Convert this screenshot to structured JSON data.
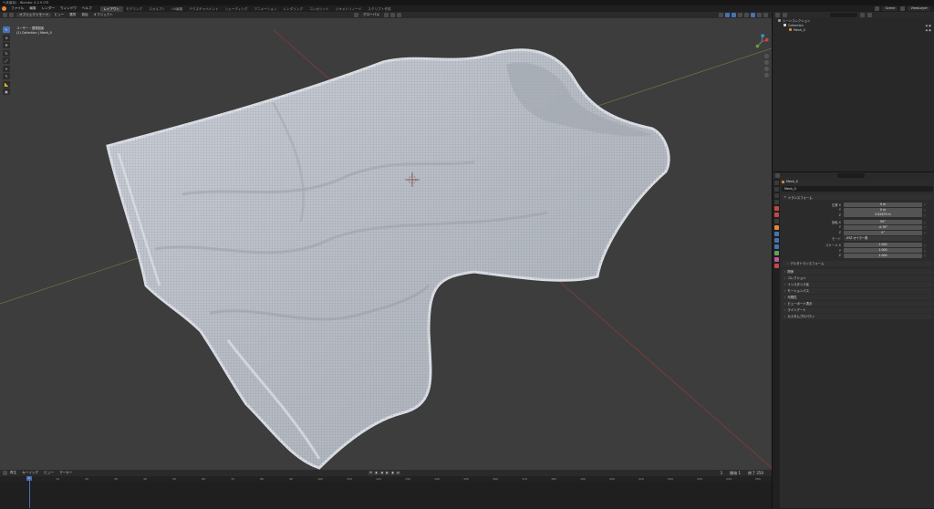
{
  "title_bar": {
    "text": "*(未保存) - Blender 4.2.9 LTS"
  },
  "menu_bar": {
    "items": [
      "ファイル",
      "編集",
      "レンダー",
      "ウィンドウ",
      "ヘルプ"
    ],
    "workspace_tabs": [
      "レイアウト",
      "モデリング",
      "スカルプト",
      "UV編集",
      "テクスチャペイント",
      "シェーディング",
      "アニメーション",
      "レンダリング",
      "コンポジット",
      "ジオメトリノード",
      "スクリプト作成"
    ],
    "active_tab_index": 0,
    "scene_label": "Scene",
    "view_layer_label": "ViewLayer"
  },
  "viewport": {
    "mode": "オブジェクトモード",
    "menus": [
      "ビュー",
      "選択",
      "追加",
      "オブジェクト"
    ],
    "transform_orientation": "グローバル",
    "info_line1": "ユーザー・透視投影",
    "info_line2": "(1) Collection | Mesh_0"
  },
  "timeline": {
    "menus": [
      "再生",
      "キーイング",
      "ビュー",
      "マーカー"
    ],
    "current_frame": "1",
    "start_label": "開始",
    "start_value": "1",
    "end_label": "終了",
    "end_value": "250",
    "ruler_marks": [
      "0",
      "10",
      "20",
      "30",
      "40",
      "50",
      "60",
      "70",
      "80",
      "90",
      "100",
      "110",
      "120",
      "130",
      "140",
      "150",
      "160",
      "170",
      "180",
      "190",
      "200",
      "210",
      "220",
      "230",
      "240",
      "250"
    ]
  },
  "outliner": {
    "rows": [
      {
        "label": "シーンコレクション",
        "indent": 0,
        "color": "#9a9a9a"
      },
      {
        "label": "Collection",
        "indent": 1,
        "color": "#dddddd"
      },
      {
        "label": "Mesh_0",
        "indent": 2,
        "color": "#e0893a"
      }
    ]
  },
  "properties": {
    "object_path": "Mesh_0",
    "object_name": "Mesh_0",
    "transform_title": "トランスフォーム",
    "location_label": "位置 X",
    "location": [
      "0 m",
      "0 m",
      "0.82879 m"
    ],
    "rotation_label": "回転 X",
    "rotation": [
      "90°",
      "-0.76°",
      "0°"
    ],
    "mode_label": "モード",
    "rotation_mode": "XYZ オイラー角",
    "scale_label": "スケール X",
    "scale": [
      "1.000",
      "1.000",
      "1.000"
    ],
    "axis_labels": [
      "Y",
      "Z"
    ],
    "delta_transform": "デルタトランスフォーム",
    "sections": [
      "関係",
      "コレクション",
      "インスタンス化",
      "モーションパス",
      "可視性",
      "ビューポート表示",
      "ラインアート",
      "カスタムプロパティ"
    ]
  }
}
